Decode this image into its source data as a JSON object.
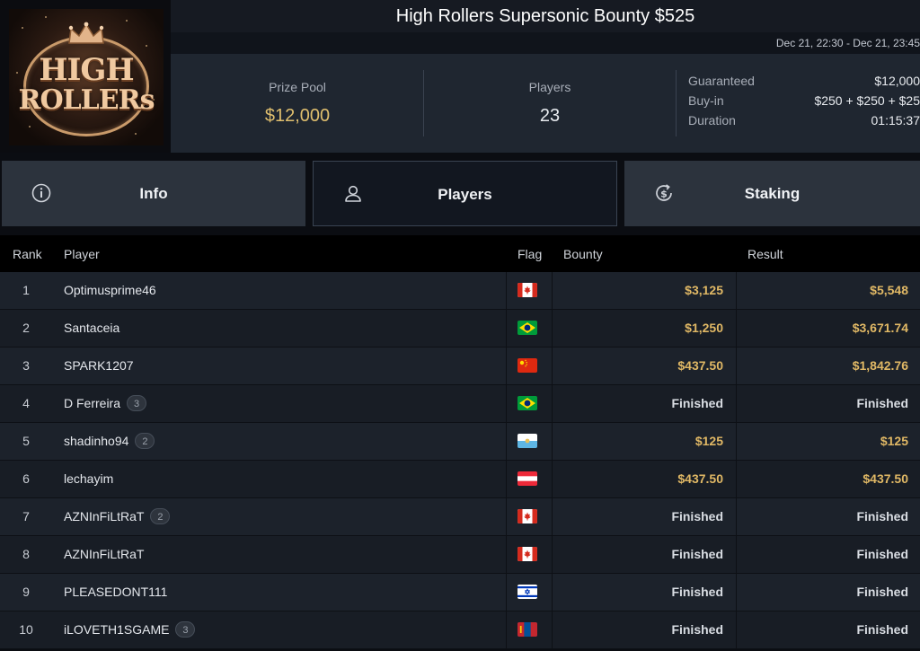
{
  "header": {
    "logo_text_line1": "HIGH",
    "logo_text_line2": "ROLLERs",
    "title": "High Rollers Supersonic Bounty $525",
    "date_range": "Dec 21, 22:30 - Dec 21, 23:45"
  },
  "stats": {
    "prize_pool_label": "Prize Pool",
    "prize_pool_value": "$12,000",
    "players_label": "Players",
    "players_value": "23",
    "details": [
      {
        "key": "Guaranteed",
        "value": "$12,000"
      },
      {
        "key": "Buy-in",
        "value": "$250 + $250 + $25"
      },
      {
        "key": "Duration",
        "value": "01:15:37"
      }
    ]
  },
  "tabs": [
    {
      "label": "Info",
      "icon": "info-icon"
    },
    {
      "label": "Players",
      "icon": "user-icon"
    },
    {
      "label": "Staking",
      "icon": "dollar-refresh-icon"
    }
  ],
  "table": {
    "headers": [
      "Rank",
      "Player",
      "Flag",
      "Bounty",
      "Result"
    ],
    "rows": [
      {
        "rank": "1",
        "player": "Optimusprime46",
        "badge": "",
        "flag": "canada",
        "bounty": "$3,125",
        "result": "$5,548"
      },
      {
        "rank": "2",
        "player": "Santaceia",
        "badge": "",
        "flag": "brazil",
        "bounty": "$1,250",
        "result": "$3,671.74"
      },
      {
        "rank": "3",
        "player": "SPARK1207",
        "badge": "",
        "flag": "china",
        "bounty": "$437.50",
        "result": "$1,842.76"
      },
      {
        "rank": "4",
        "player": "D Ferreira",
        "badge": "3",
        "flag": "brazil",
        "bounty": "Finished",
        "result": "Finished"
      },
      {
        "rank": "5",
        "player": "shadinho94",
        "badge": "2",
        "flag": "san-marino",
        "bounty": "$125",
        "result": "$125"
      },
      {
        "rank": "6",
        "player": "lechayim",
        "badge": "",
        "flag": "austria",
        "bounty": "$437.50",
        "result": "$437.50"
      },
      {
        "rank": "7",
        "player": "AZNInFiLtRaT",
        "badge": "2",
        "flag": "canada",
        "bounty": "Finished",
        "result": "Finished"
      },
      {
        "rank": "8",
        "player": "AZNInFiLtRaT",
        "badge": "",
        "flag": "canada",
        "bounty": "Finished",
        "result": "Finished"
      },
      {
        "rank": "9",
        "player": "PLEASEDONT111",
        "badge": "",
        "flag": "israel",
        "bounty": "Finished",
        "result": "Finished"
      },
      {
        "rank": "10",
        "player": "iLOVETH1SGAME",
        "badge": "3",
        "flag": "mongolia",
        "bounty": "Finished",
        "result": "Finished"
      }
    ]
  },
  "colors": {
    "money": "#e0b865",
    "prize": "#e0bf6e",
    "background": "#0b0d12",
    "row": "#1c222b"
  }
}
